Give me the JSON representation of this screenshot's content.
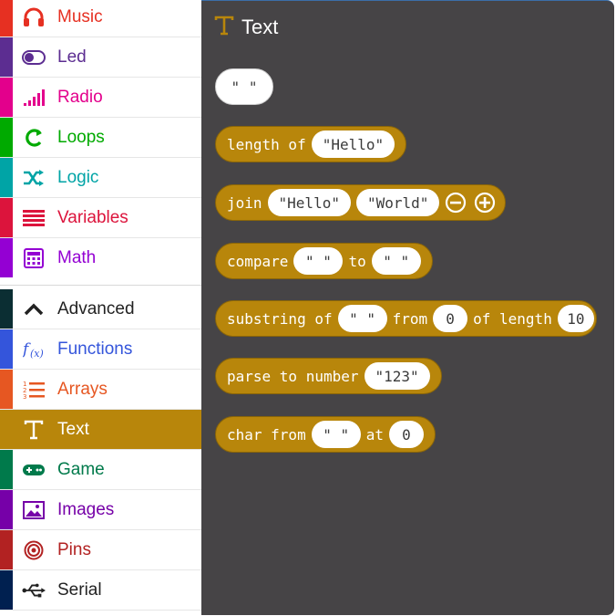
{
  "sidebar": {
    "items": [
      {
        "label": "Music",
        "color": "#e63022",
        "icon": "headphones-icon"
      },
      {
        "label": "Led",
        "color": "#5c2d91",
        "icon": "toggle-icon"
      },
      {
        "label": "Radio",
        "color": "#e3008c",
        "icon": "signal-bars-icon"
      },
      {
        "label": "Loops",
        "color": "#00aa00",
        "icon": "loop-arrow-icon"
      },
      {
        "label": "Logic",
        "color": "#00a4a6",
        "icon": "shuffle-icon"
      },
      {
        "label": "Variables",
        "color": "#dc143c",
        "icon": "lines-icon"
      },
      {
        "label": "Math",
        "color": "#9400d3",
        "icon": "calculator-icon"
      },
      {
        "label": "Advanced",
        "color": "#3c3c3c",
        "icon": "chevron-up-icon"
      },
      {
        "label": "Functions",
        "color": "#3455db",
        "icon": "function-icon"
      },
      {
        "label": "Arrays",
        "color": "#e65722",
        "icon": "list-icon"
      },
      {
        "label": "Text",
        "color": "#b8860b",
        "icon": "text-icon",
        "selected": true
      },
      {
        "label": "Game",
        "color": "#007a4b",
        "icon": "gamepad-icon"
      },
      {
        "label": "Images",
        "color": "#7600a8",
        "icon": "image-icon"
      },
      {
        "label": "Pins",
        "color": "#b22222",
        "icon": "target-icon"
      },
      {
        "label": "Serial",
        "color": "#002050",
        "icon": "usb-icon"
      }
    ]
  },
  "flyout": {
    "title": "Text",
    "accent": "#b8860b",
    "blocks": {
      "empty_string": "\" \"",
      "length": {
        "kw": "length of",
        "arg": "\"Hello\""
      },
      "join": {
        "kw": "join",
        "arg1": "\"Hello\"",
        "arg2": "\"World\""
      },
      "compare": {
        "kw": "compare",
        "arg1": "\" \"",
        "kw2": "to",
        "arg2": "\" \""
      },
      "substring": {
        "kw": "substring of",
        "arg1": "\" \"",
        "kw2": "from",
        "arg2": "0",
        "kw3": "of length",
        "arg3": "10"
      },
      "parse": {
        "kw": "parse to number",
        "arg": "\"123\""
      },
      "charfrom": {
        "kw": "char from",
        "arg1": "\" \"",
        "kw2": "at",
        "arg2": "0"
      }
    }
  }
}
